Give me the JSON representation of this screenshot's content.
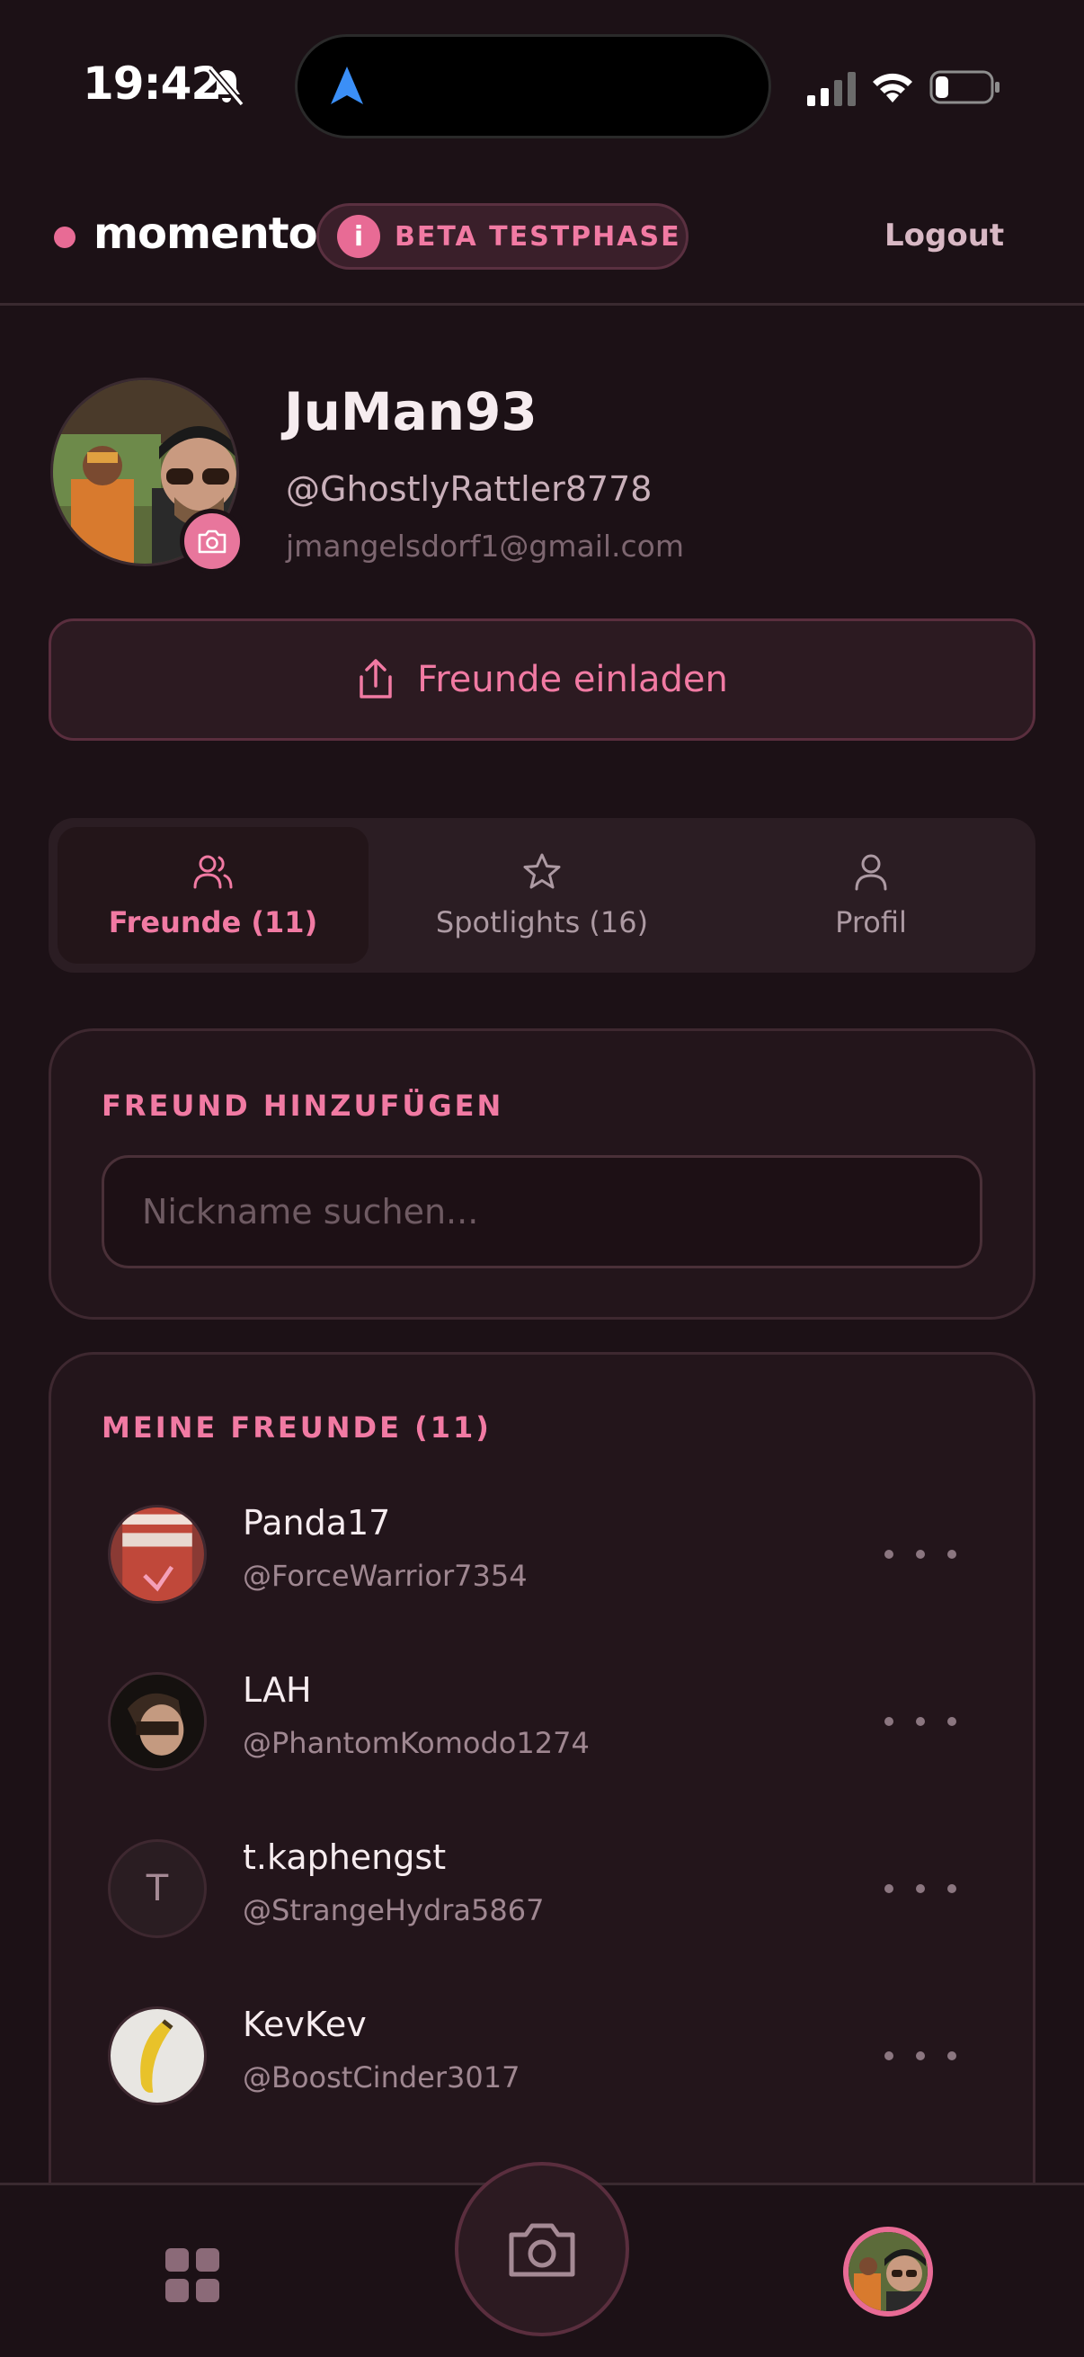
{
  "status_bar": {
    "time": "19:42"
  },
  "header": {
    "brand": "momento",
    "beta_badge": "BETA TESTPHASE",
    "logout": "Logout",
    "accent_color": "#e86b95"
  },
  "profile": {
    "username": "JuMan93",
    "handle": "@GhostlyRattler8778",
    "email": "jmangelsdorf1@gmail.com",
    "invite_label": "Freunde einladen"
  },
  "tabs": [
    {
      "label": "Freunde (11)",
      "icon": "users-icon",
      "active": true
    },
    {
      "label": "Spotlights (16)",
      "icon": "star-icon",
      "active": false
    },
    {
      "label": "Profil",
      "icon": "user-icon",
      "active": false
    }
  ],
  "add_friend": {
    "title": "FREUND HINZUFÜGEN",
    "placeholder": "Nickname suchen..."
  },
  "friends": {
    "title": "MEINE FREUNDE (11)",
    "items": [
      {
        "name": "Panda17",
        "handle": "@ForceWarrior7354",
        "avatar": "photo"
      },
      {
        "name": "LAH",
        "handle": "@PhantomKomodo1274",
        "avatar": "photo"
      },
      {
        "name": "t.kaphengst",
        "handle": "@StrangeHydra5867",
        "avatar": "initial",
        "initial": "T"
      },
      {
        "name": "KevKev",
        "handle": "@BoostCinder3017",
        "avatar": "photo"
      }
    ]
  },
  "bottom_nav": {
    "left_icon": "grid-icon",
    "center_icon": "camera-icon",
    "right_icon": "avatar"
  }
}
